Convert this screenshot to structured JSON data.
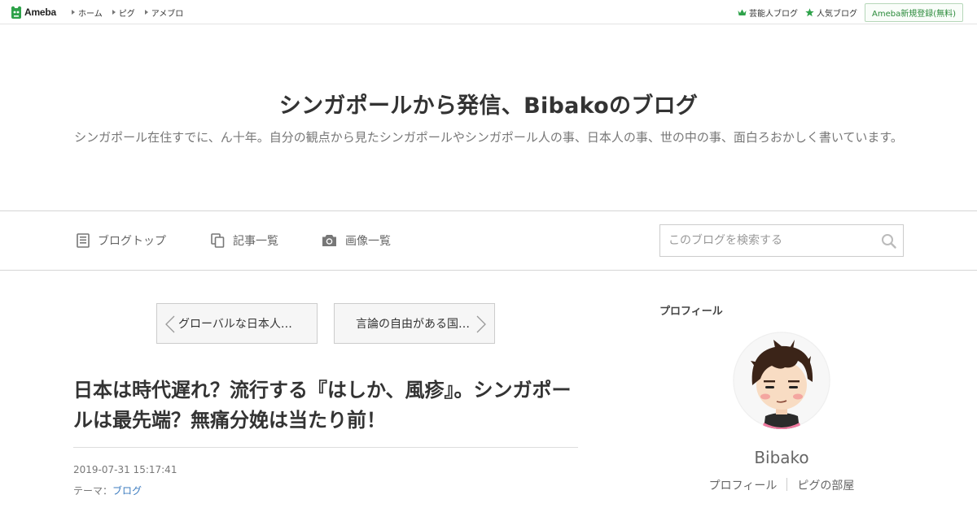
{
  "topbar": {
    "logo_text": "Ameba",
    "nav": [
      {
        "label": "ホーム"
      },
      {
        "label": "ピグ"
      },
      {
        "label": "アメブロ"
      }
    ],
    "right_links": [
      {
        "label": "芸能人ブログ",
        "icon": "crown-icon"
      },
      {
        "label": "人気ブログ",
        "icon": "star-icon"
      }
    ],
    "register_label": "Ameba新規登録(無料)"
  },
  "header": {
    "title": "シンガポールから発信、Bibakoのブログ",
    "description": "シンガポール在住すでに、ん十年。自分の観点から見たシンガポールやシンガポール人の事、日本人の事、世の中の事、面白ろおかしく書いています。"
  },
  "blognav": {
    "items": [
      {
        "label": "ブログトップ",
        "icon": "document-icon"
      },
      {
        "label": "記事一覧",
        "icon": "copy-icon"
      },
      {
        "label": "画像一覧",
        "icon": "camera-icon"
      }
    ],
    "search_placeholder": "このブログを検索する"
  },
  "pager": {
    "prev_label": "グローバルな日本人…",
    "next_label": "言論の自由がある国…"
  },
  "entry": {
    "title": "日本は時代遅れ？流行する『はしか、風疹』。シンガポールは最先端？無痛分娩は当たり前！",
    "date": "2019-07-31 15:17:41",
    "theme_prefix": "テーマ：",
    "theme_link": "ブログ"
  },
  "sidebar": {
    "heading": "プロフィール",
    "name": "Bibako",
    "links": [
      {
        "label": "プロフィール"
      },
      {
        "label": "ピグの部屋"
      }
    ]
  },
  "colors": {
    "accent_green": "#2a8a3a",
    "link_blue": "#3b7bbf",
    "text": "#333333"
  }
}
